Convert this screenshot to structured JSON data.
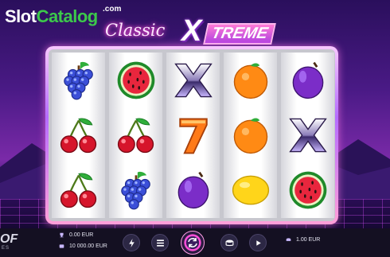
{
  "watermark": {
    "slot": "Slot",
    "catalog": "Catalog",
    "com": ".com"
  },
  "logo": {
    "classic": "Classic",
    "x": "X",
    "treme": "TREME"
  },
  "reels": [
    [
      "grapes-icon",
      "cherries-icon",
      "cherries-icon"
    ],
    [
      "watermelon-icon",
      "cherries-icon",
      "grapes-icon"
    ],
    [
      "x-symbol-icon",
      "seven-icon",
      "plum-icon"
    ],
    [
      "orange-icon",
      "orange-icon",
      "lemon-icon"
    ],
    [
      "plum-icon",
      "x-symbol-icon",
      "watermelon-icon"
    ]
  ],
  "footer": {
    "provider": "OF",
    "provider_sub": "ES",
    "win": "0.00 EUR",
    "balance": "10 000.00 EUR",
    "bet": "1.00 EUR"
  },
  "colors": {
    "accent": "#ff4fd8",
    "bar": "#141022",
    "watermark_green": "#3cc84b"
  }
}
